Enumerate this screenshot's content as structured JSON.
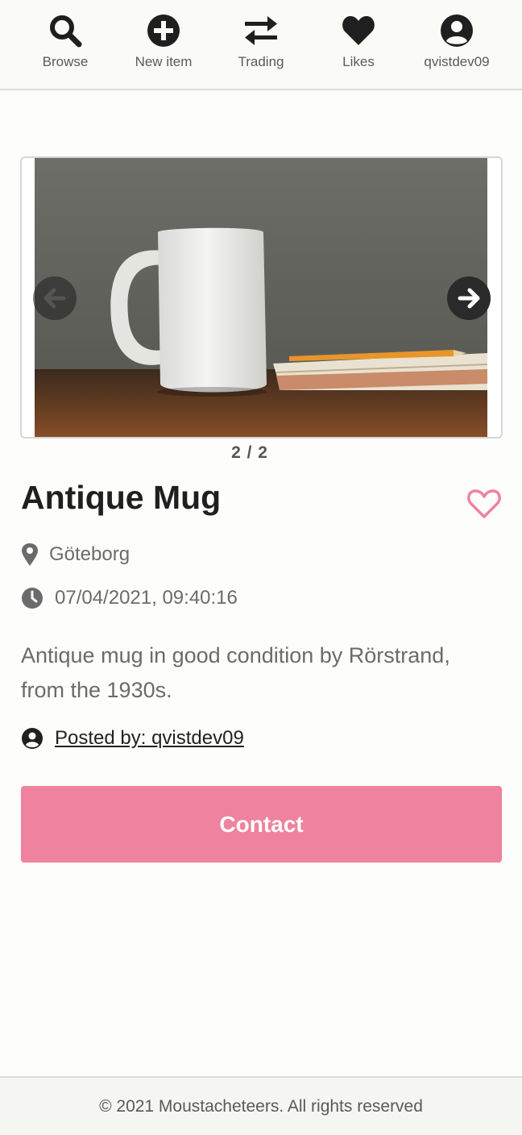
{
  "nav": {
    "items": [
      {
        "label": "Browse",
        "icon": "search-icon"
      },
      {
        "label": "New item",
        "icon": "plus-circle-icon"
      },
      {
        "label": "Trading",
        "icon": "swap-arrows-icon"
      },
      {
        "label": "Likes",
        "icon": "heart-icon"
      },
      {
        "label": "qvistdev09",
        "icon": "user-circle-icon"
      }
    ]
  },
  "carousel": {
    "counter": "2 / 2",
    "image_subject": "white mug on wooden table beside notebook and pencil"
  },
  "item": {
    "title": "Antique Mug",
    "location": "Göteborg",
    "timestamp": "07/04/2021, 09:40:16",
    "description": "Antique mug in good condition by Rörstrand, from the 1930s.",
    "posted_by": "Posted by: qvistdev09",
    "contact_label": "Contact"
  },
  "footer": {
    "text": "© 2021 Moustacheteers. All rights reserved"
  },
  "colors": {
    "accent": "#ef829e",
    "heart_outline": "#ef829e",
    "text_muted": "#6b6b6b",
    "text_dark": "#1f1f1f"
  }
}
